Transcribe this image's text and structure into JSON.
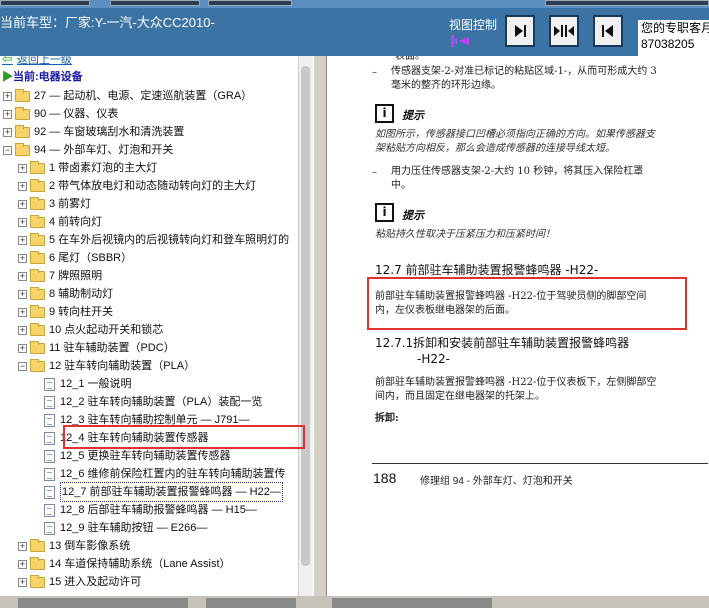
{
  "header": {
    "car_model": "当前车型：厂家:Y-一汽-大众CC2010-",
    "view_control": "视图控制",
    "dealer_line1": "您的专职客月",
    "dealer_line2": "87038205",
    "bg_color": "#3a73a4"
  },
  "view_buttons": [
    {
      "icon": "arrow-right-bar-icon"
    },
    {
      "icon": "arrows-split-icon"
    },
    {
      "icon": "arrow-left-bar-icon"
    }
  ],
  "tree": {
    "back_label": "返回上一级",
    "current_label": "当前:电器设备",
    "items": [
      {
        "label": "27 — 起动机、电源、定速巡航装置（GRA）",
        "type": "folder",
        "level": 0
      },
      {
        "label": "90 — 仪器、仪表",
        "type": "folder",
        "level": 0
      },
      {
        "label": "92 — 车窗玻璃刮水和清洗装置",
        "type": "folder",
        "level": 0
      },
      {
        "label": "94 — 外部车灯、灯泡和开关",
        "type": "folder",
        "level": 0,
        "expanded": true
      },
      {
        "label": "1 带卤素灯泡的主大灯",
        "type": "folder",
        "level": 1
      },
      {
        "label": "2 带气体放电灯和动态随动转向灯的主大灯",
        "type": "folder",
        "level": 1
      },
      {
        "label": "3 前雾灯",
        "type": "folder",
        "level": 1
      },
      {
        "label": "4 前转向灯",
        "type": "folder",
        "level": 1
      },
      {
        "label": "5 在车外后视镜内的后视镜转向灯和登车照明灯的",
        "type": "folder",
        "level": 1
      },
      {
        "label": "6 尾灯（SBBR）",
        "type": "folder",
        "level": 1
      },
      {
        "label": "7 牌照照明",
        "type": "folder",
        "level": 1
      },
      {
        "label": "8 辅助制动灯",
        "type": "folder",
        "level": 1
      },
      {
        "label": "9 转向柱开关",
        "type": "folder",
        "level": 1
      },
      {
        "label": "10 点火起动开关和锁芯",
        "type": "folder",
        "level": 1
      },
      {
        "label": "11 驻车辅助装置（PDC）",
        "type": "folder",
        "level": 1
      },
      {
        "label": "12 驻车转向辅助装置（PLA）",
        "type": "folder",
        "level": 1,
        "expanded": true
      },
      {
        "label": "12_1 一般说明",
        "type": "doc",
        "level": 2
      },
      {
        "label": "12_2 驻车转向辅助装置（PLA）装配一览",
        "type": "doc",
        "level": 2
      },
      {
        "label": "12_3 驻车转向辅助控制单元 — J791—",
        "type": "doc",
        "level": 2
      },
      {
        "label": "12_4 驻车转向辅助装置传感器",
        "type": "doc",
        "level": 2
      },
      {
        "label": "12_5 更换驻车转向辅助装置传感器",
        "type": "doc",
        "level": 2
      },
      {
        "label": "12_6 维修前保险杠置内的驻车转向辅助装置传",
        "type": "doc",
        "level": 2
      },
      {
        "label": "12_7 前部驻车辅助装置报警蜂鸣器 — H22—",
        "type": "doc",
        "level": 2,
        "selected": true
      },
      {
        "label": "12_8 后部驻车辅助报警蜂鸣器 — H15—",
        "type": "doc",
        "level": 2
      },
      {
        "label": "12_9 驻车辅助按钮 — E266—",
        "type": "doc",
        "level": 2
      },
      {
        "label": "13 倒车影像系统",
        "type": "folder",
        "level": 1
      },
      {
        "label": "14 车道保持辅助系统（Lane Assist）",
        "type": "folder",
        "level": 1
      },
      {
        "label": "15 进入及起动许可",
        "type": "folder",
        "level": 1
      }
    ]
  },
  "document": {
    "top_fragment": "表面。",
    "bullet1_line1": "传感器支架-2-对准已标记的粘贴区域-1-，从而可形成大约 3",
    "bullet1_line2": "毫米的整齐的环形边缘。",
    "note_label": "提示",
    "note1_line1": "如图所示，传感器接口凹槽必须指向正确的方向。如果传感器支",
    "note1_line2": "架粘贴方向相反，那么会造成传感器的连接导线太短。",
    "bullet2_line1": "用力压住传感器支架-2-大约 10 秒钟，将其压入保险杠罩",
    "bullet2_line2": "中。",
    "note2_text": "粘贴持久性取决于压紧压力和压紧时间！",
    "sec_title": "12.7  前部驻车辅助装置报警蜂鸣器 -H22-",
    "sec_line1": "前部驻车辅助装置报警蜂鸣器 -H22-位于驾驶员侧的脚部空间",
    "sec_line2": "内，左仪表板继电器架的后面。",
    "sub_title1": "12.7.1拆卸和安装前部驻车辅助装置报警蜂鸣器",
    "sub_title2": "-H22-",
    "sub_line1": "前部驻车辅助装置报警蜂鸣器 -H22-位于仪表板下，左侧脚部空",
    "sub_line2": "间内，而且固定在继电器架的托架上。",
    "remove_label": "拆卸:",
    "page_number": "188",
    "page_footer": "修理组 94  -  外部车灯、灯泡和开关",
    "highlight_color": "#e03030"
  }
}
